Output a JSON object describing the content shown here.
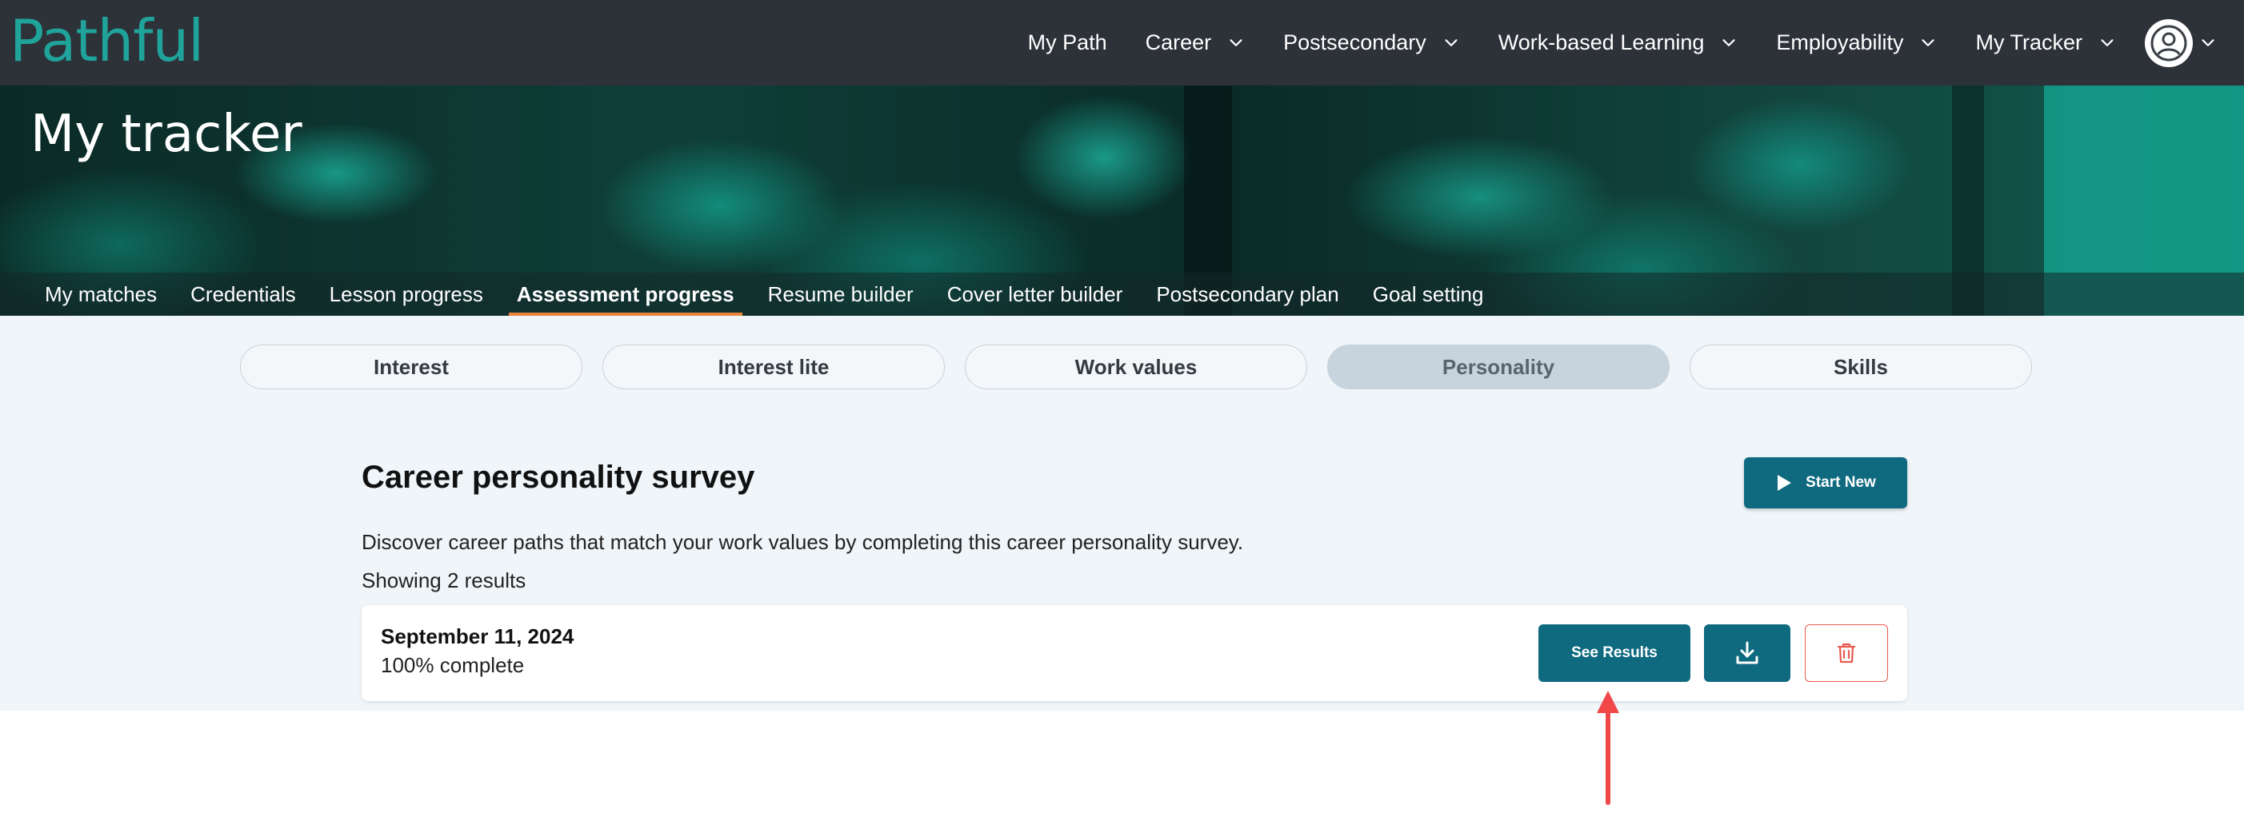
{
  "brand": {
    "logo_text": "Pathful",
    "accent": "#1fa39a"
  },
  "nav": {
    "items": [
      {
        "label": "My Path",
        "dropdown": false
      },
      {
        "label": "Career",
        "dropdown": true
      },
      {
        "label": "Postsecondary",
        "dropdown": true
      },
      {
        "label": "Work-based Learning",
        "dropdown": true
      },
      {
        "label": "Employability",
        "dropdown": true
      },
      {
        "label": "My Tracker",
        "dropdown": true
      }
    ],
    "avatar_icon": "user-circle-icon"
  },
  "hero": {
    "title": "My tracker"
  },
  "subnav": {
    "items": [
      {
        "label": "My matches"
      },
      {
        "label": "Credentials"
      },
      {
        "label": "Lesson progress"
      },
      {
        "label": "Assessment progress",
        "active": true
      },
      {
        "label": "Resume builder"
      },
      {
        "label": "Cover letter builder"
      },
      {
        "label": "Postsecondary plan"
      },
      {
        "label": "Goal setting"
      }
    ],
    "active_color": "#e8833a"
  },
  "assessment_tabs": {
    "items": [
      {
        "label": "Interest"
      },
      {
        "label": "Interest lite"
      },
      {
        "label": "Work values"
      },
      {
        "label": "Personality",
        "active": true
      },
      {
        "label": "Skills"
      }
    ]
  },
  "survey": {
    "title": "Career personality survey",
    "start_label": "Start New",
    "description": "Discover career paths that match your work values by completing this career personality survey.",
    "count": "Showing 2 results"
  },
  "results": [
    {
      "date": "September 11, 2024",
      "progress": "100% complete",
      "see_results_label": "See Results",
      "download_icon": "download-icon",
      "delete_icon": "trash-icon"
    }
  ],
  "colors": {
    "primary_button": "#0f6a80",
    "danger": "#e85a4f",
    "annotation_arrow": "#f04848"
  }
}
